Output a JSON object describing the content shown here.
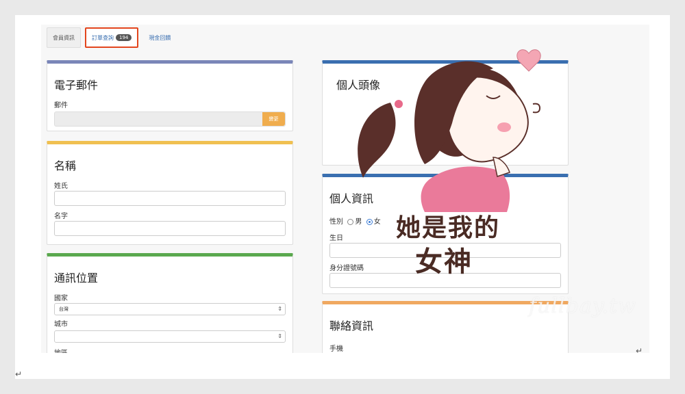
{
  "tabs": {
    "profile": "會員資訊",
    "orders": "訂單查詢",
    "orders_badge": "194",
    "logout": "現金回饋"
  },
  "email_card": {
    "title": "電子郵件",
    "label": "郵件",
    "button": "變更",
    "accent": "#7a86b8"
  },
  "name_card": {
    "title": "名稱",
    "surname_label": "姓氏",
    "given_label": "名字",
    "accent": "#f0c050"
  },
  "address_card": {
    "title": "通訊位置",
    "country_label": "國家",
    "country_value": "台灣",
    "city_label": "城市",
    "district_label": "地區",
    "accent": "#5aa84e"
  },
  "avatar_card": {
    "title": "個人頭像",
    "accent": "#3a6fb0"
  },
  "personal_card": {
    "title": "個人資訊",
    "gender_label": "性別",
    "male": "男",
    "female": "女",
    "birthday_label": "生日",
    "id_label": "身分證號碼",
    "accent": "#3a6fb0"
  },
  "contact_card": {
    "title": "聯絡資訊",
    "mobile_label": "手機",
    "accent": "#f0a860"
  },
  "sticker": {
    "line1": "她是我的",
    "line2": "女神"
  },
  "watermark": "fullbay.tw",
  "para_mark_1": "↵",
  "para_mark_2": "↵"
}
